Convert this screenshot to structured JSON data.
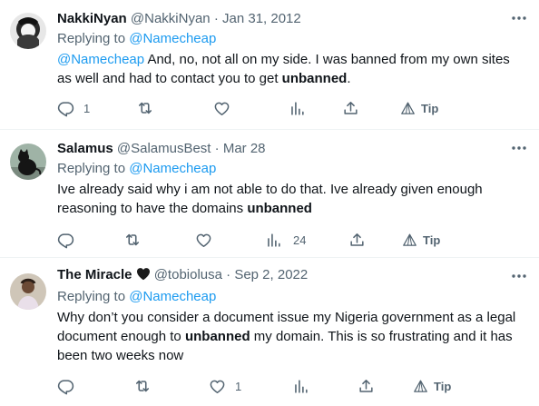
{
  "tweets": [
    {
      "name": "NakkiNyan",
      "handle": "@NakkiNyan",
      "separator": "·",
      "date": "Jan 31, 2012",
      "replying_prefix": "Replying to ",
      "replying_to": "@Namecheap",
      "body_mention": "@Namecheap",
      "body_part1": " And, no, not all on my side. I was banned from my own sites as well and had to contact you to get ",
      "body_bold": "unbanned",
      "body_part2": ".",
      "reply_count": "1",
      "view_count": "",
      "tip_label": "Tip"
    },
    {
      "name": "Salamus",
      "handle": "@SalamusBest",
      "separator": "·",
      "date": "Mar 28",
      "replying_prefix": "Replying to ",
      "replying_to": "@Namecheap",
      "body_part1": "Ive already said why i am not able to do that. Ive already given enough reasoning to have the domains ",
      "body_bold": "unbanned",
      "body_part2": "",
      "reply_count": "",
      "view_count": "24",
      "tip_label": "Tip"
    },
    {
      "name": "The Miracle",
      "handle": "@tobiolusa",
      "separator": "·",
      "date": "Sep 2, 2022",
      "replying_prefix": "Replying to ",
      "replying_to": "@Namecheap",
      "body_part1": "Why don’t you consider a document issue my Nigeria government as a legal document enough to ",
      "body_bold": "unbanned",
      "body_part2": " my domain. This is so frustrating and it has been two weeks now",
      "like_count": "1",
      "tip_label": "Tip"
    }
  ],
  "colors": {
    "text": "#0f1419",
    "secondary": "#536471",
    "link": "#1d9bf0",
    "divider": "#eff3f4"
  },
  "icons": [
    "reply-icon",
    "retweet-icon",
    "like-icon",
    "views-icon",
    "share-icon",
    "tip-icon",
    "more-icon",
    "black-heart-icon"
  ]
}
